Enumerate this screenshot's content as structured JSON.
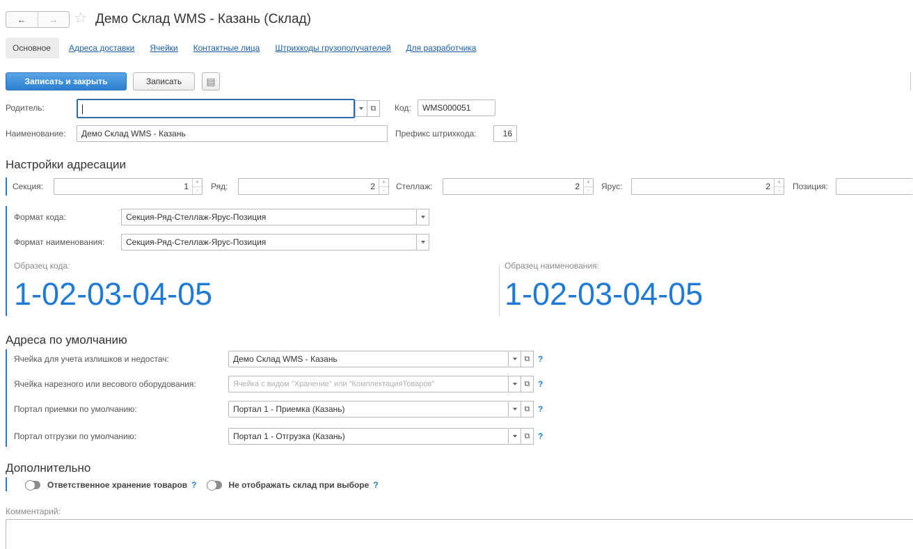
{
  "window": {
    "back_icon": "arrow-left",
    "forward_icon": "arrow-right",
    "favorite_icon": "star-outline",
    "title": "Демо Склад WMS - Казань (Склад)"
  },
  "tabs": [
    {
      "label": "Основное",
      "active": true
    },
    {
      "label": "Адреса доставки",
      "active": false
    },
    {
      "label": "Ячейки",
      "active": false
    },
    {
      "label": "Контактные лица",
      "active": false
    },
    {
      "label": "Штрихкоды грузополучателей",
      "active": false
    },
    {
      "label": "Для разработчика",
      "active": false
    }
  ],
  "toolbar": {
    "save_close_label": "Записать и закрыть",
    "save_label": "Записать",
    "more_icon": "document-list-icon"
  },
  "form": {
    "parent": {
      "label": "Родитель:",
      "value": ""
    },
    "code": {
      "label": "Код:",
      "value": "WMS000051"
    },
    "name": {
      "label": "Наименование:",
      "value": "Демо Склад WMS - Казань"
    },
    "barcode_prefix": {
      "label": "Префикс штрихкода:",
      "value": "16"
    }
  },
  "addressing": {
    "title": "Настройки адресации",
    "section": {
      "label": "Секция:",
      "value": "1"
    },
    "row": {
      "label": "Ряд:",
      "value": "2"
    },
    "rack": {
      "label": "Стеллаж:",
      "value": "2"
    },
    "tier": {
      "label": "Ярус:",
      "value": "2"
    },
    "position": {
      "label": "Позиция:",
      "value": ""
    },
    "code_format": {
      "label": "Формат кода:",
      "value": "Секция-Ряд-Стеллаж-Ярус-Позиция"
    },
    "name_format": {
      "label": "Формат наименования:",
      "value": "Секция-Ряд-Стеллаж-Ярус-Позиция"
    },
    "code_sample": {
      "label": "Образец кода:",
      "value": "1-02-03-04-05"
    },
    "name_sample": {
      "label": "Образец наименования:",
      "value": "1-02-03-04-05"
    }
  },
  "defaults": {
    "title": "Адреса по умолчанию",
    "surplus_cell": {
      "label": "Ячейка для учета излишков и недостач:",
      "value": "Демо Склад WMS - Казань"
    },
    "cutting_cell": {
      "label": "Ячейка нарезного или весового оборудования:",
      "placeholder": "Ячейка с видом \"Хранение\" или \"КомплектацияТоваров\""
    },
    "receipt_portal": {
      "label": "Портал приемки по умолчанию:",
      "value": "Портал 1 - Приемка (Казань)"
    },
    "shipment_portal": {
      "label": "Портал отгрузки по умолчанию:",
      "value": "Портал 1 - Отгрузка (Казань)"
    },
    "help_mark": "?"
  },
  "extra": {
    "title": "Дополнительно",
    "custody_label": "Ответственное хранение товаров",
    "custody_on": false,
    "hide_label": "Не отображать склад при выборе",
    "hide_on": false,
    "help_mark": "?"
  },
  "comment": {
    "label": "Комментарий:",
    "value": ""
  },
  "colors": {
    "accent_blue": "#2c80d0",
    "sample_blue": "#1f7ad6",
    "link_blue": "#1a5fa8",
    "group_bar": "#2a75c6"
  }
}
